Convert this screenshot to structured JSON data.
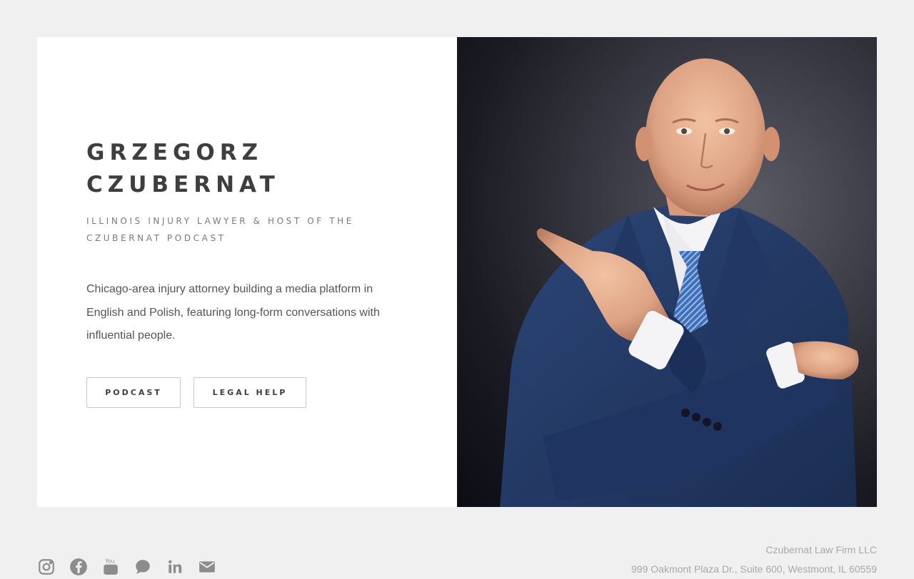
{
  "hero": {
    "name_line1": "GRZEGORZ",
    "name_line2": "CZUBERNAT",
    "subtitle": "ILLINOIS INJURY LAWYER & HOST OF THE CZUBERNAT PODCAST",
    "bio": "Chicago-area injury attorney building a media platform in English and Polish, featuring long-form conversations with influential people.",
    "buttons": {
      "podcast_label": "PODCAST",
      "legal_help_label": "LEGAL HELP"
    }
  },
  "portrait": {
    "description_icon": "portrait-photo",
    "background_color": "#1a1a22",
    "suit_color": "#243a66",
    "tie_color": "#3f6fb8"
  },
  "footer": {
    "social_icons": [
      "instagram-icon",
      "facebook-icon",
      "youtube-icon",
      "chat-icon",
      "linkedin-icon",
      "mail-icon"
    ],
    "firm_name": "Czubernat Law Firm LLC",
    "address": "999 Oakmont Plaza Dr., Suite 600, Westmont, IL 60559"
  },
  "colors": {
    "page_background": "#f0f0f0",
    "card_background": "#ffffff",
    "heading_text": "#3e3e3e",
    "muted_text": "#7a7a7a",
    "footer_text": "#a8a8a8"
  }
}
